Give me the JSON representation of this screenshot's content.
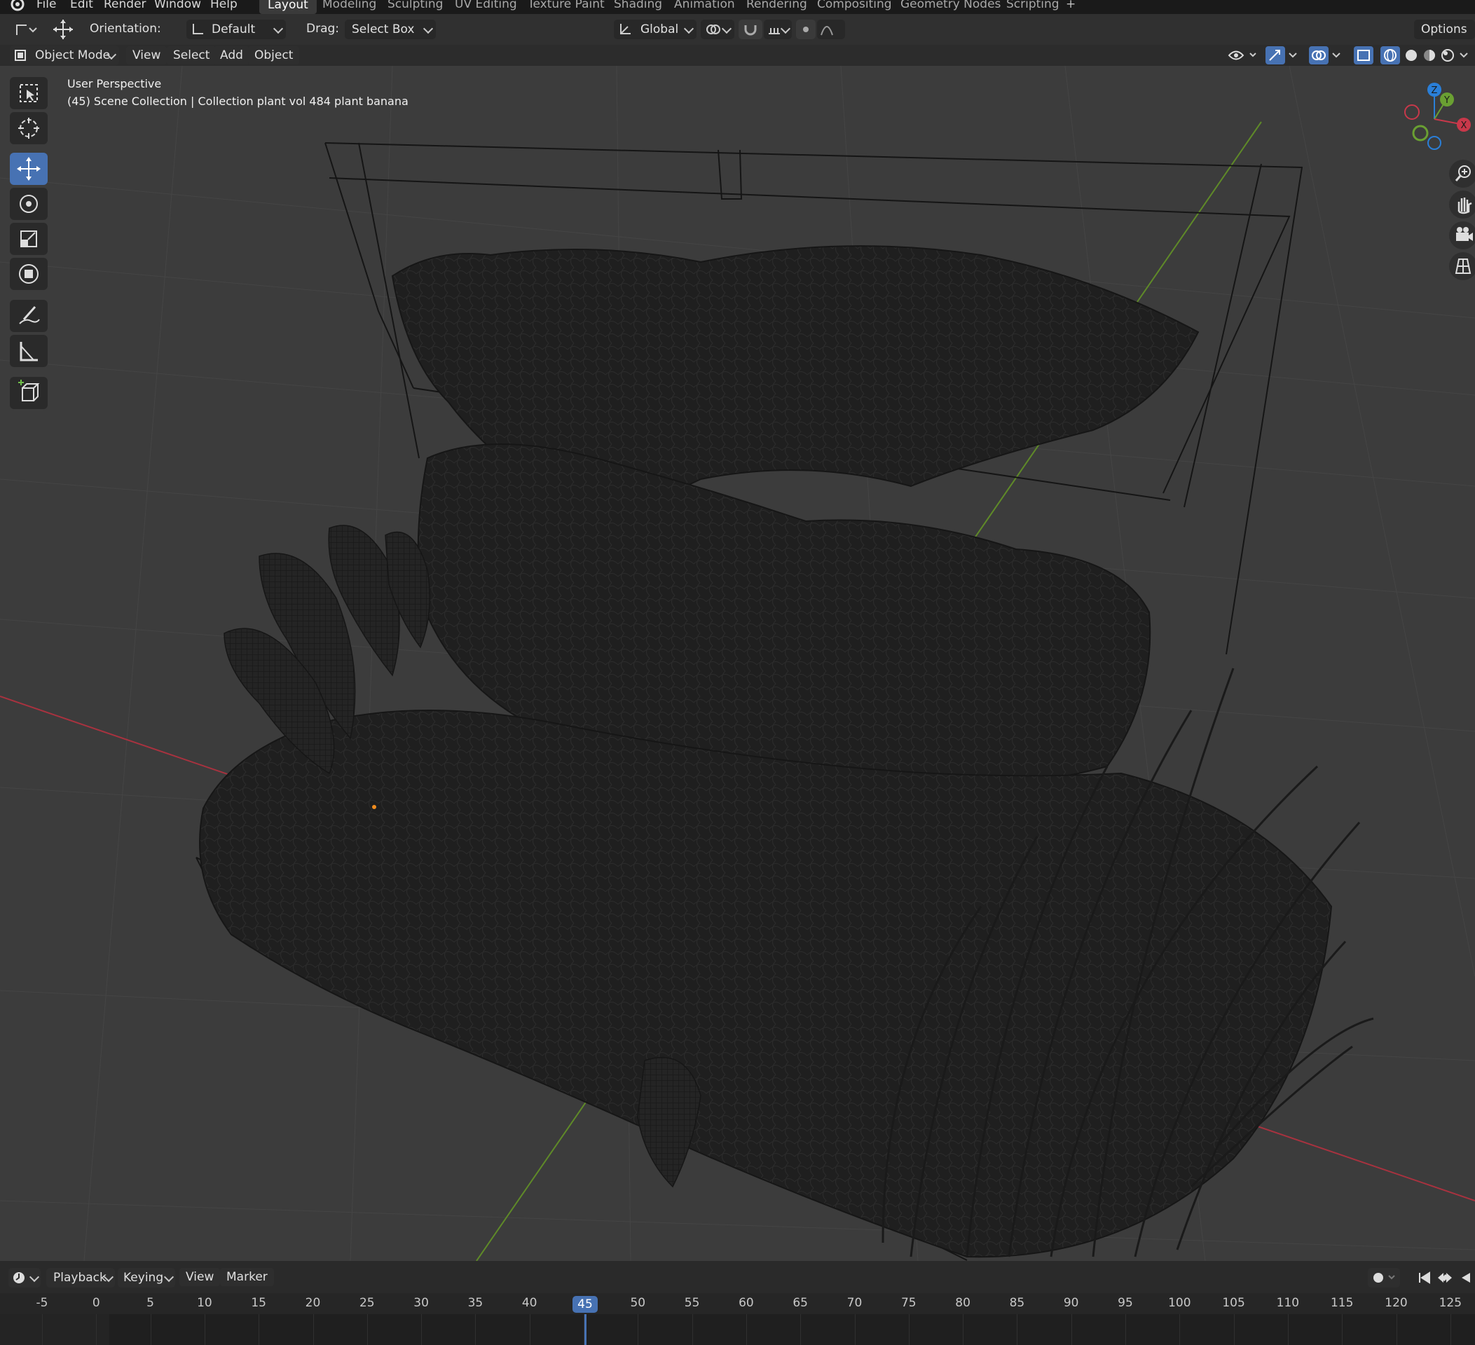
{
  "menu": [
    "File",
    "Edit",
    "Render",
    "Window",
    "Help"
  ],
  "workspaces": [
    "Layout",
    "Modeling",
    "Sculpting",
    "UV Editing",
    "Texture Paint",
    "Shading",
    "Animation",
    "Rendering",
    "Compositing",
    "Geometry Nodes",
    "Scripting"
  ],
  "active_workspace": "Layout",
  "add_workspace": "+",
  "header": {
    "orientation_label": "Orientation:",
    "orientation_value": "Default",
    "drag_label": "Drag:",
    "drag_value": "Select Box",
    "transform_space": "Global",
    "options_label": "Options"
  },
  "viewport_header": {
    "mode": "Object Mode",
    "menus": [
      "View",
      "Select",
      "Add",
      "Object"
    ]
  },
  "viewport": {
    "perspective_label": "User Perspective",
    "collection_label": "(45) Scene Collection | Collection plant vol 484 plant banana",
    "gizmo_axes": [
      "Z",
      "Y",
      "X"
    ]
  },
  "colors": {
    "accent": "#4772b3",
    "x_axis": "#c8384a",
    "y_axis": "#6aa032",
    "z_axis": "#2a7fd8"
  },
  "toolbar_icons": [
    "select-box-icon",
    "cursor-icon",
    "move-icon",
    "rotate-icon",
    "scale-icon",
    "transform-icon",
    "annotate-icon",
    "measure-icon",
    "add-cube-icon"
  ],
  "timeline": {
    "menus": [
      "Playback",
      "Keying",
      "View",
      "Marker"
    ],
    "ticks": [
      "-5",
      "0",
      "5",
      "10",
      "15",
      "20",
      "25",
      "30",
      "35",
      "40",
      "45",
      "50",
      "55",
      "60",
      "65",
      "70",
      "75",
      "80",
      "85",
      "90",
      "95",
      "100",
      "105",
      "110",
      "115",
      "120",
      "125"
    ],
    "current_frame": "45"
  }
}
